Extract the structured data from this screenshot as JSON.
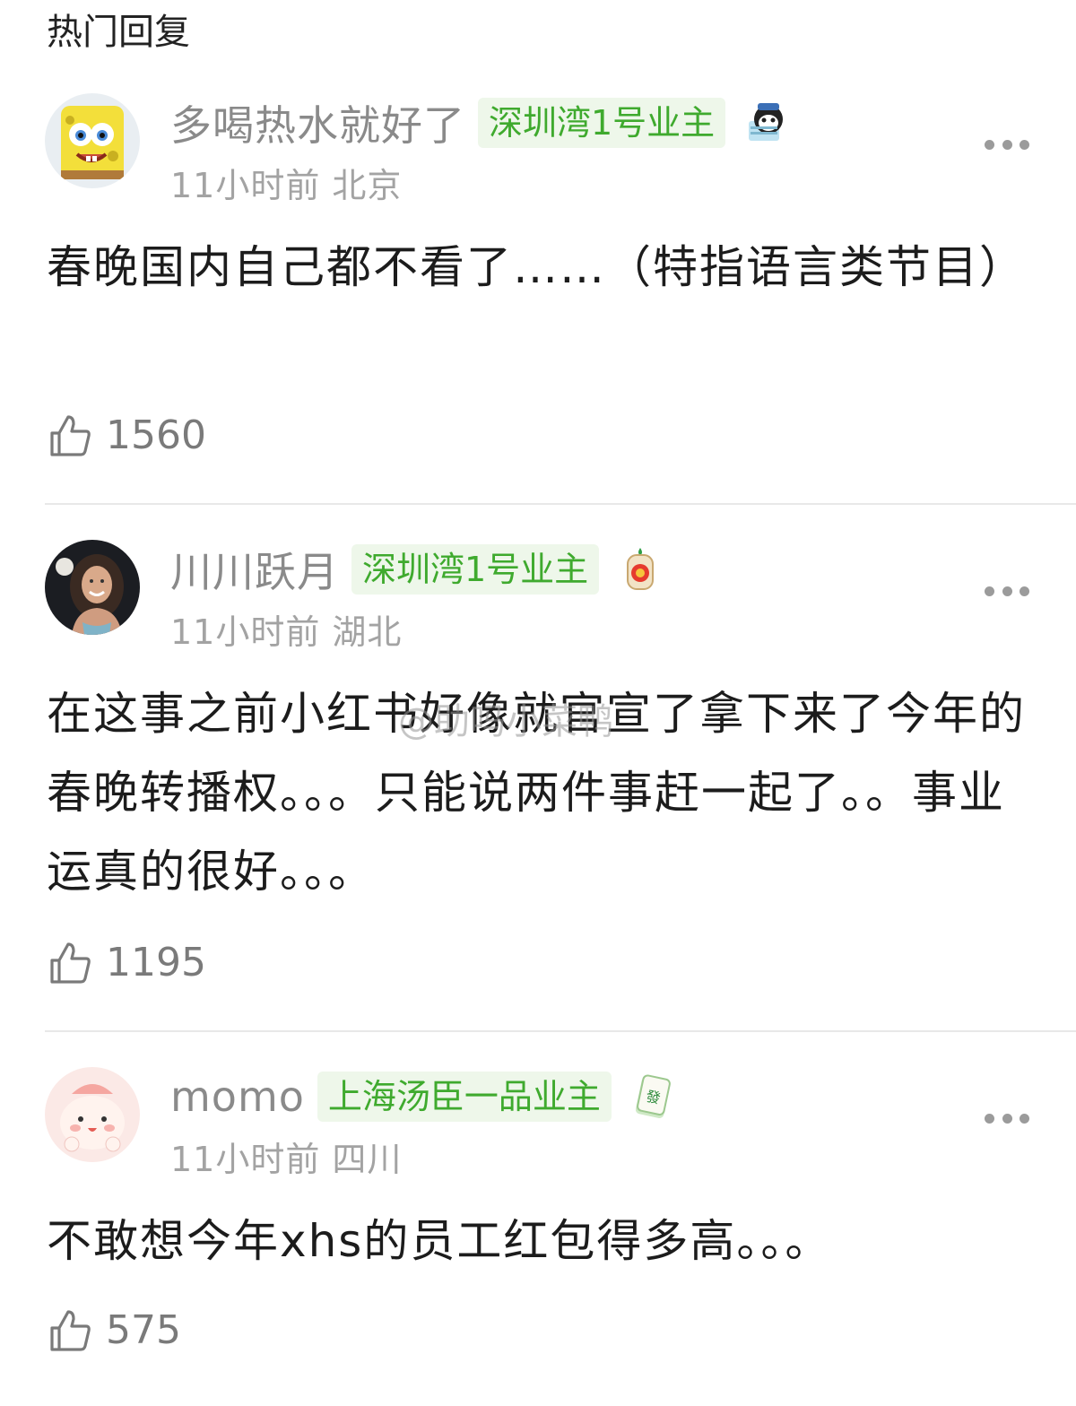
{
  "section_title": "热门回复",
  "watermark": "@助吗小菜鸭",
  "comments": [
    {
      "username": "多喝热水就好了",
      "badge": "深圳湾1号业主",
      "time_location": "11小时前 北京",
      "text": "春晚国内自己都不看了……（特指语言类节目）",
      "likes": "1560",
      "medal_icon": "mascot-medal-icon",
      "avatar_icon": "spongebob-avatar"
    },
    {
      "username": "川川跃月",
      "badge": "深圳湾1号业主",
      "time_location": "11小时前 湖北",
      "text": "在这事之前小红书好像就官宣了拿下来了今年的春晚转播权。。。只能说两件事赶一起了。。事业运真的很好。。。",
      "likes": "1195",
      "medal_icon": "lucky-charm-medal-icon",
      "avatar_icon": "photo-avatar"
    },
    {
      "username": "momo",
      "badge": "上海汤臣一品业主",
      "time_location": "11小时前 四川",
      "text": "不敢想今年xhs的员工红包得多高。。。",
      "likes": "575",
      "medal_icon": "mahjong-fa-medal-icon",
      "avatar_icon": "cartoon-avatar"
    }
  ],
  "colors": {
    "badge_text": "#3faa2e",
    "badge_bg": "#eef7ea",
    "username": "#8a8a8a",
    "meta": "#a3a3a3"
  }
}
